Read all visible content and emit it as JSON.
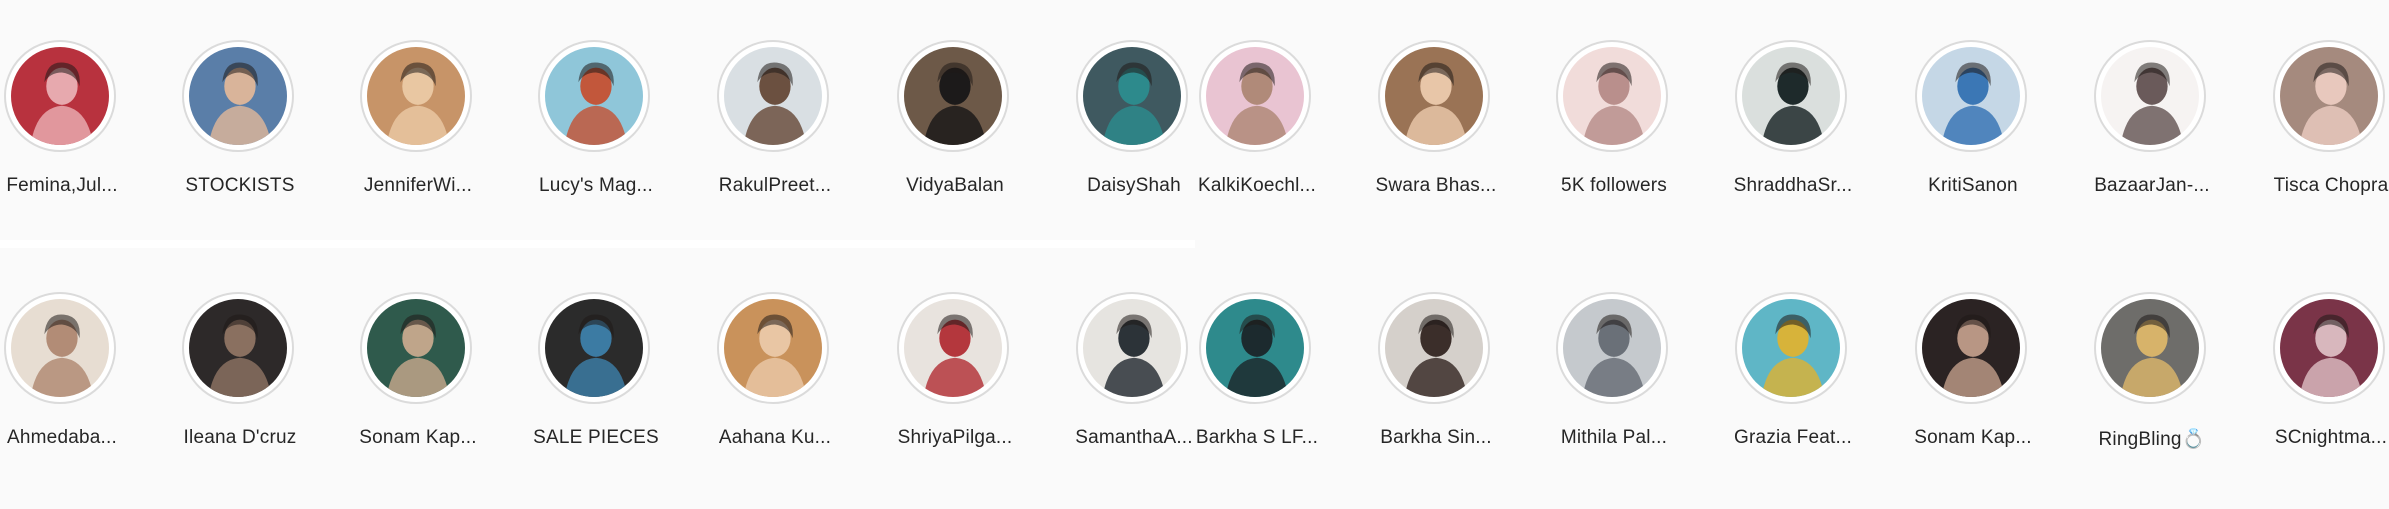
{
  "highlights": {
    "row1": [
      {
        "label": "Femina,Jul...",
        "bg": "#b8323e",
        "fg": "#e7a9ae"
      },
      {
        "label": "STOCKISTS",
        "bg": "#5a7ea8",
        "fg": "#d9b49a"
      },
      {
        "label": "JenniferWi...",
        "bg": "#c79468",
        "fg": "#e9c7a2"
      },
      {
        "label": "Lucy's Mag...",
        "bg": "#8fc6d9",
        "fg": "#c2573b"
      },
      {
        "label": "RakulPreet...",
        "bg": "#d9dfe3",
        "fg": "#6b5040"
      },
      {
        "label": "VidyaBalan",
        "bg": "#6d5948",
        "fg": "#1c1a1a"
      },
      {
        "label": "DaisyShah",
        "bg": "#3f5960",
        "fg": "#2d8a8c"
      },
      {
        "label": "KalkiKoechl...",
        "bg": "#e9c4d2",
        "fg": "#b08a79"
      },
      {
        "label": "Swara Bhas...",
        "bg": "#9a7355",
        "fg": "#e8c6a8"
      },
      {
        "label": "5K followers",
        "bg": "#f1dcda",
        "fg": "#b98f8c"
      },
      {
        "label": "ShraddhaSr...",
        "bg": "#dadfdd",
        "fg": "#1e2a2b"
      },
      {
        "label": "KritiSanon",
        "bg": "#c5d7e6",
        "fg": "#3b77b5"
      },
      {
        "label": "BazaarJan-...",
        "bg": "#f6f3f2",
        "fg": "#6a5a5a"
      },
      {
        "label": "Tisca Chopra",
        "bg": "#a58a7e",
        "fg": "#e8c8bd"
      }
    ],
    "row2": [
      {
        "label": "Ahmedaba...",
        "bg": "#e7ddd2",
        "fg": "#b28c76"
      },
      {
        "label": "Ileana D'cruz",
        "bg": "#2d2929",
        "fg": "#8a7060"
      },
      {
        "label": "Sonam Kap...",
        "bg": "#2f5a4c",
        "fg": "#bfa58a"
      },
      {
        "label": "SALE PIECES",
        "bg": "#2b2b2b",
        "fg": "#3c7ba3"
      },
      {
        "label": "Aahana Ku...",
        "bg": "#c9925b",
        "fg": "#e9c6a4"
      },
      {
        "label": "ShriyaPilga...",
        "bg": "#e8e3de",
        "fg": "#b4373d"
      },
      {
        "label": "SamanthaA...",
        "bg": "#e6e4e0",
        "fg": "#2c3338"
      },
      {
        "label": "Barkha S LF...",
        "bg": "#2e8a8c",
        "fg": "#1c2a2e"
      },
      {
        "label": "Barkha Sin...",
        "bg": "#d5d0cb",
        "fg": "#3b2e2a"
      },
      {
        "label": "Mithila Pal...",
        "bg": "#c5c9cd",
        "fg": "#6a7078"
      },
      {
        "label": "Grazia Feat...",
        "bg": "#5fb6c6",
        "fg": "#d7b33a"
      },
      {
        "label": "Sonam Kap...",
        "bg": "#2b2323",
        "fg": "#b89684"
      },
      {
        "label": "RingBling💍",
        "bg": "#6e6d6a",
        "fg": "#d7b36a"
      },
      {
        "label": "SCnightma...",
        "bg": "#7a3448",
        "fg": "#d8b7bd"
      }
    ]
  }
}
